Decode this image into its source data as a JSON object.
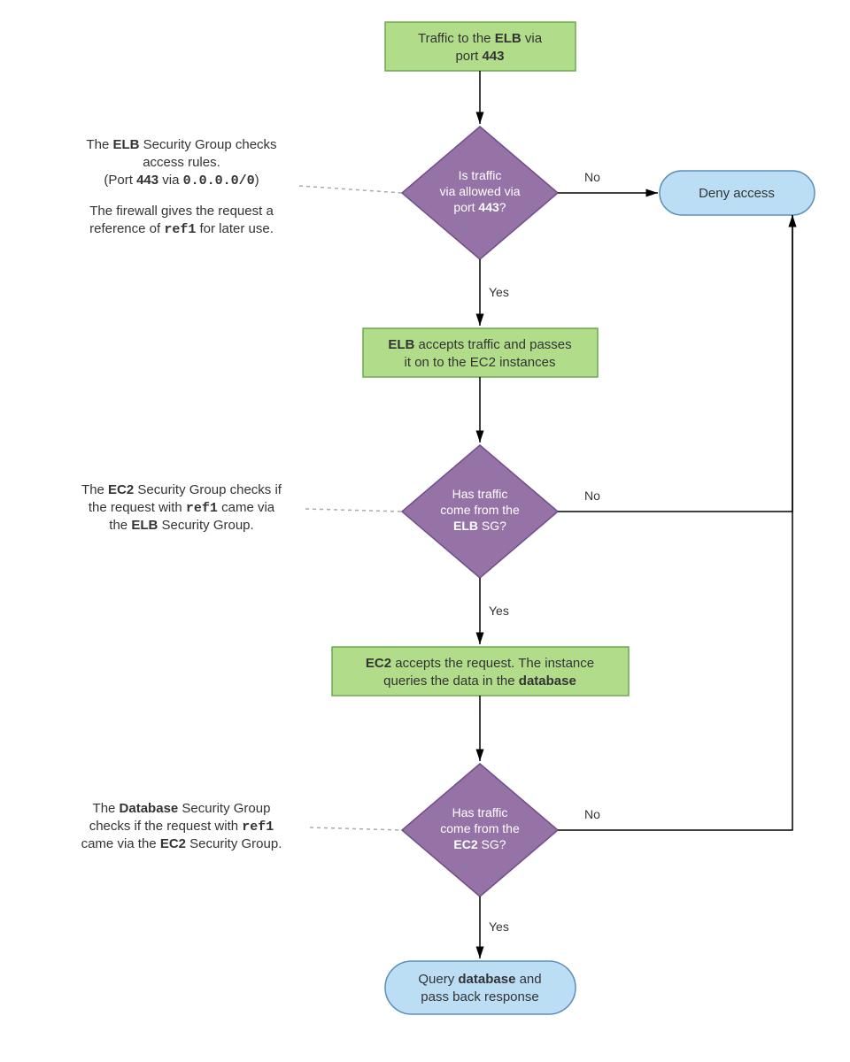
{
  "colors": {
    "process_fill": "#b1dd8b",
    "process_stroke": "#6aa84f",
    "decision_fill": "#9673a6",
    "decision_stroke": "#714e89",
    "terminal_fill": "#bcdef5",
    "terminal_stroke": "#5b8fb9"
  },
  "nodes": {
    "start": {
      "text_pre": "Traffic to the ",
      "bold1": "ELB",
      "mid": " via",
      "line2_pre": "port ",
      "bold2": "443"
    },
    "d1": {
      "l1": "Is traffic",
      "l2": "via allowed via",
      "l3a": "port ",
      "l3b": "443",
      "l3c": "?"
    },
    "p2": {
      "bold1": "ELB",
      "rest1": " accepts traffic and passes",
      "l2": "it on to the EC2 instances"
    },
    "d2": {
      "l1": "Has traffic",
      "l2": "come from the",
      "l3a": "ELB",
      "l3b": " SG?"
    },
    "p3": {
      "bold1": "EC2",
      "rest1": " accepts the request. The instance",
      "l2a": "queries the data in the ",
      "l2b": "database"
    },
    "d3": {
      "l1": "Has traffic",
      "l2": "come from the",
      "l3a": "EC2",
      "l3b": " SG?"
    },
    "deny": {
      "text": "Deny access"
    },
    "end": {
      "l1a": "Query ",
      "l1b": "database",
      "l1c": " and",
      "l2": "pass back response"
    }
  },
  "annotations": {
    "a1": {
      "l1a": "The ",
      "l1b": "ELB",
      "l1c": " Security Group checks",
      "l2": "access rules.",
      "l3a": "(Port ",
      "l3b": "443",
      "l3c": " via ",
      "l3d": "0.0.0.0/0",
      "l3e": ")",
      "l4": "The firewall gives the request a",
      "l5a": "reference of ",
      "l5b": "ref1",
      "l5c": " for later use."
    },
    "a2": {
      "l1a": "The ",
      "l1b": "EC2",
      "l1c": " Security Group checks if",
      "l2a": "the request with ",
      "l2b": "ref1",
      "l2c": " came via",
      "l3a": "the ",
      "l3b": "ELB",
      "l3c": " Security Group."
    },
    "a3": {
      "l1a": "The ",
      "l1b": "Database",
      "l1c": " Security Group",
      "l2a": "checks if the request with ",
      "l2b": "ref1",
      "l3a": "came via the ",
      "l3b": "EC2",
      "l3c": " Security Group."
    }
  },
  "labels": {
    "yes": "Yes",
    "no": "No"
  }
}
